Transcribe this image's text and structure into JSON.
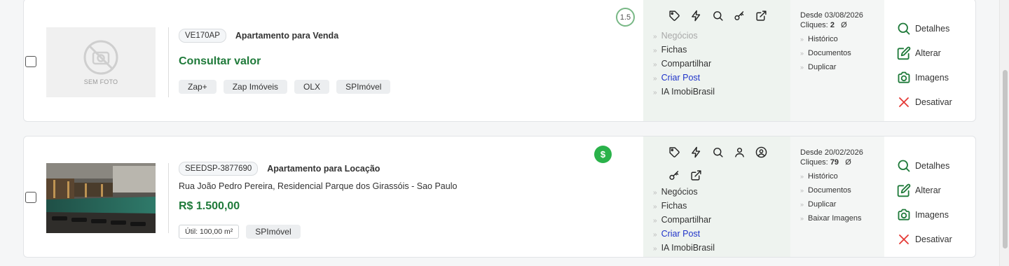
{
  "listings": [
    {
      "code": "VE170AP",
      "type": "Apartamento para Venda",
      "address": "",
      "price": "Consultar valor",
      "no_photo_label": "SEM FOTO",
      "portals": [
        "Zap+",
        "Zap Imóveis",
        "OLX",
        "SPImóvel"
      ],
      "area": "",
      "score": "1.5",
      "action_icons": [
        "tag-icon",
        "bolt-icon",
        "search-icon",
        "key-icon",
        "external-link-icon"
      ],
      "menu": [
        "Negócios",
        "Fichas",
        "Compartilhar",
        "Criar Post",
        "IA ImobiBrasil"
      ],
      "since": "Desde 03/08/2026",
      "clicks_label": "Cliques:",
      "clicks_value": "2",
      "clicks_suffix": "Ø",
      "history_menu": [
        "Histórico",
        "Documentos",
        "Duplicar"
      ],
      "buttons": [
        "Detalhes",
        "Alterar",
        "Imagens",
        "Desativar"
      ]
    },
    {
      "code": "SEEDSP-3877690",
      "type": "Apartamento para Locação",
      "address": "Rua João Pedro Pereira, Residencial Parque dos Girassóis - Sao Paulo",
      "price": "R$ 1.500,00",
      "area": "Útil: 100,00 m²",
      "portals": [
        "SPImóvel"
      ],
      "badge": "$",
      "action_icons": [
        "tag-icon",
        "bolt-icon",
        "search-icon",
        "user-icon",
        "user-circle-icon",
        "key-icon",
        "external-link-icon"
      ],
      "menu": [
        "Negócios",
        "Fichas",
        "Compartilhar",
        "Criar Post",
        "IA ImobiBrasil"
      ],
      "since": "Desde 20/02/2026",
      "clicks_label": "Cliques:",
      "clicks_value": "79",
      "clicks_suffix": "Ø",
      "history_menu": [
        "Histórico",
        "Documentos",
        "Duplicar",
        "Baixar Imagens"
      ],
      "buttons": [
        "Detalhes",
        "Alterar",
        "Imagens",
        "Desativar"
      ]
    }
  ],
  "colors": {
    "green": "#1f7a3a",
    "link": "#1f33c9",
    "danger": "#e53935",
    "badge_green": "#2ab24a"
  }
}
